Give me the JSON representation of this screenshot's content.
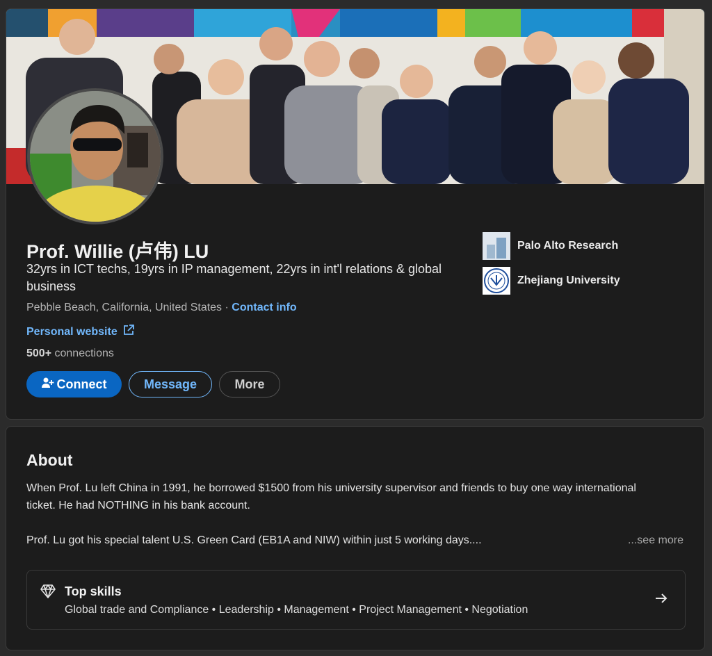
{
  "profile": {
    "name": "Prof. Willie (卢伟) LU",
    "headline": "32yrs in ICT techs, 19yrs in IP management, 22yrs in int'l relations & global business",
    "location": "Pebble Beach, California, United States",
    "separator": "·",
    "contact_label": "Contact info",
    "website_label": "Personal website",
    "connections_count": "500+",
    "connections_label": "connections",
    "buttons": {
      "connect": "Connect",
      "message": "Message",
      "more": "More"
    },
    "orgs": [
      {
        "name": "Palo Alto Research",
        "icon": "company-logo-icon"
      },
      {
        "name": "Zhejiang University",
        "icon": "university-seal-icon"
      }
    ]
  },
  "about": {
    "title": "About",
    "paragraph1": "When Prof. Lu left China in 1991, he borrowed $1500 from his university supervisor and friends to buy one way international ticket. He had NOTHING in his bank account.",
    "paragraph2": "Prof. Lu got his special talent U.S. Green Card (EB1A and NIW) within just 5 working days....",
    "see_more": "...see more",
    "skills": {
      "title": "Top skills",
      "list": "Global trade and Compliance • Leadership • Management • Project Management • Negotiation",
      "icon": "diamond-icon"
    }
  },
  "colors": {
    "accent": "#0a66c2",
    "link": "#71b7fb",
    "card_bg": "#1c1c1c",
    "page_bg": "#2b2b2b"
  }
}
